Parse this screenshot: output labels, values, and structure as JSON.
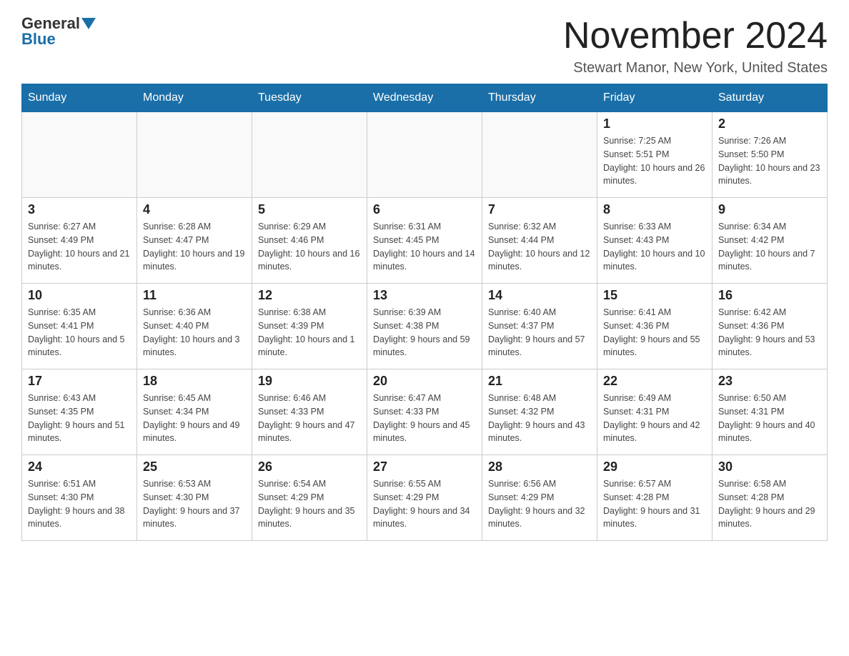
{
  "logo": {
    "general": "General",
    "blue": "Blue",
    "subtitle": "Blue"
  },
  "header": {
    "month_title": "November 2024",
    "location": "Stewart Manor, New York, United States"
  },
  "weekdays": [
    "Sunday",
    "Monday",
    "Tuesday",
    "Wednesday",
    "Thursday",
    "Friday",
    "Saturday"
  ],
  "weeks": [
    [
      {
        "day": "",
        "info": ""
      },
      {
        "day": "",
        "info": ""
      },
      {
        "day": "",
        "info": ""
      },
      {
        "day": "",
        "info": ""
      },
      {
        "day": "",
        "info": ""
      },
      {
        "day": "1",
        "info": "Sunrise: 7:25 AM\nSunset: 5:51 PM\nDaylight: 10 hours and 26 minutes."
      },
      {
        "day": "2",
        "info": "Sunrise: 7:26 AM\nSunset: 5:50 PM\nDaylight: 10 hours and 23 minutes."
      }
    ],
    [
      {
        "day": "3",
        "info": "Sunrise: 6:27 AM\nSunset: 4:49 PM\nDaylight: 10 hours and 21 minutes."
      },
      {
        "day": "4",
        "info": "Sunrise: 6:28 AM\nSunset: 4:47 PM\nDaylight: 10 hours and 19 minutes."
      },
      {
        "day": "5",
        "info": "Sunrise: 6:29 AM\nSunset: 4:46 PM\nDaylight: 10 hours and 16 minutes."
      },
      {
        "day": "6",
        "info": "Sunrise: 6:31 AM\nSunset: 4:45 PM\nDaylight: 10 hours and 14 minutes."
      },
      {
        "day": "7",
        "info": "Sunrise: 6:32 AM\nSunset: 4:44 PM\nDaylight: 10 hours and 12 minutes."
      },
      {
        "day": "8",
        "info": "Sunrise: 6:33 AM\nSunset: 4:43 PM\nDaylight: 10 hours and 10 minutes."
      },
      {
        "day": "9",
        "info": "Sunrise: 6:34 AM\nSunset: 4:42 PM\nDaylight: 10 hours and 7 minutes."
      }
    ],
    [
      {
        "day": "10",
        "info": "Sunrise: 6:35 AM\nSunset: 4:41 PM\nDaylight: 10 hours and 5 minutes."
      },
      {
        "day": "11",
        "info": "Sunrise: 6:36 AM\nSunset: 4:40 PM\nDaylight: 10 hours and 3 minutes."
      },
      {
        "day": "12",
        "info": "Sunrise: 6:38 AM\nSunset: 4:39 PM\nDaylight: 10 hours and 1 minute."
      },
      {
        "day": "13",
        "info": "Sunrise: 6:39 AM\nSunset: 4:38 PM\nDaylight: 9 hours and 59 minutes."
      },
      {
        "day": "14",
        "info": "Sunrise: 6:40 AM\nSunset: 4:37 PM\nDaylight: 9 hours and 57 minutes."
      },
      {
        "day": "15",
        "info": "Sunrise: 6:41 AM\nSunset: 4:36 PM\nDaylight: 9 hours and 55 minutes."
      },
      {
        "day": "16",
        "info": "Sunrise: 6:42 AM\nSunset: 4:36 PM\nDaylight: 9 hours and 53 minutes."
      }
    ],
    [
      {
        "day": "17",
        "info": "Sunrise: 6:43 AM\nSunset: 4:35 PM\nDaylight: 9 hours and 51 minutes."
      },
      {
        "day": "18",
        "info": "Sunrise: 6:45 AM\nSunset: 4:34 PM\nDaylight: 9 hours and 49 minutes."
      },
      {
        "day": "19",
        "info": "Sunrise: 6:46 AM\nSunset: 4:33 PM\nDaylight: 9 hours and 47 minutes."
      },
      {
        "day": "20",
        "info": "Sunrise: 6:47 AM\nSunset: 4:33 PM\nDaylight: 9 hours and 45 minutes."
      },
      {
        "day": "21",
        "info": "Sunrise: 6:48 AM\nSunset: 4:32 PM\nDaylight: 9 hours and 43 minutes."
      },
      {
        "day": "22",
        "info": "Sunrise: 6:49 AM\nSunset: 4:31 PM\nDaylight: 9 hours and 42 minutes."
      },
      {
        "day": "23",
        "info": "Sunrise: 6:50 AM\nSunset: 4:31 PM\nDaylight: 9 hours and 40 minutes."
      }
    ],
    [
      {
        "day": "24",
        "info": "Sunrise: 6:51 AM\nSunset: 4:30 PM\nDaylight: 9 hours and 38 minutes."
      },
      {
        "day": "25",
        "info": "Sunrise: 6:53 AM\nSunset: 4:30 PM\nDaylight: 9 hours and 37 minutes."
      },
      {
        "day": "26",
        "info": "Sunrise: 6:54 AM\nSunset: 4:29 PM\nDaylight: 9 hours and 35 minutes."
      },
      {
        "day": "27",
        "info": "Sunrise: 6:55 AM\nSunset: 4:29 PM\nDaylight: 9 hours and 34 minutes."
      },
      {
        "day": "28",
        "info": "Sunrise: 6:56 AM\nSunset: 4:29 PM\nDaylight: 9 hours and 32 minutes."
      },
      {
        "day": "29",
        "info": "Sunrise: 6:57 AM\nSunset: 4:28 PM\nDaylight: 9 hours and 31 minutes."
      },
      {
        "day": "30",
        "info": "Sunrise: 6:58 AM\nSunset: 4:28 PM\nDaylight: 9 hours and 29 minutes."
      }
    ]
  ]
}
